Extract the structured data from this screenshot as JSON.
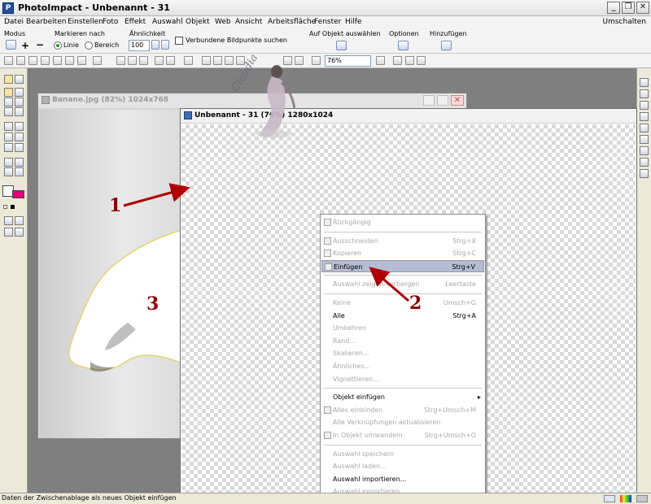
{
  "titlebar": {
    "title": "PhotoImpact - Unbenannt - 31",
    "minimize_icon": "minimize-icon",
    "maximize_icon": "restore-icon",
    "close_icon": "close-icon"
  },
  "menubar": {
    "items": [
      "Datei",
      "Bearbeiten",
      "Einstellen",
      "Foto",
      "Effekt",
      "Auswahl",
      "Objekt",
      "Web",
      "Ansicht",
      "Arbeitsfläche",
      "Fenster",
      "Hilfe"
    ],
    "right": "Umschalten"
  },
  "attributes": {
    "modus_label": "Modus",
    "markieren_label": "Markieren nach",
    "radio_linie": "Linie",
    "radio_bereich": "Bereich",
    "aehnlichkeit_label": "Ähnlichkeit",
    "aehnlichkeit_value": "100",
    "verbundene_label": "Verbundene Bildpunkte suchen",
    "auf_objekt_label": "Auf Objekt auswählen",
    "optionen_label": "Optionen",
    "hinzufuegen_label": "Hinzufügen"
  },
  "toolbar": {
    "zoom_value": "76%"
  },
  "window_banana": {
    "title": "Banane.jpg (82%) 1024x768"
  },
  "window_main": {
    "title": "Unbenannt - 31 (76%) 1280x1024"
  },
  "watermark": "Claudia",
  "context_menu": {
    "items": [
      {
        "label": "Rückgängig",
        "shortcut": "",
        "enabled": false,
        "icon": "undo-icon"
      },
      {
        "sep": true
      },
      {
        "label": "Ausschneiden",
        "shortcut": "Strg+X",
        "enabled": false,
        "icon": "scissors-icon"
      },
      {
        "label": "Kopieren",
        "shortcut": "Strg+C",
        "enabled": false,
        "icon": "copy-icon"
      },
      {
        "label": "Einfügen",
        "shortcut": "Strg+V",
        "enabled": true,
        "icon": "paste-icon",
        "highlight": true
      },
      {
        "sep": true
      },
      {
        "label": "Auswahl zeigen/verbergen",
        "shortcut": "Leertaste",
        "enabled": false
      },
      {
        "sep": true
      },
      {
        "label": "Keine",
        "shortcut": "Umsch+G",
        "enabled": false
      },
      {
        "label": "Alle",
        "shortcut": "Strg+A",
        "enabled": true
      },
      {
        "label": "Umkehren",
        "shortcut": "",
        "enabled": false
      },
      {
        "label": "Rand...",
        "shortcut": "",
        "enabled": false
      },
      {
        "label": "Skalieren...",
        "shortcut": "",
        "enabled": false
      },
      {
        "label": "Ähnliches...",
        "shortcut": "",
        "enabled": false
      },
      {
        "label": "Vignettieren...",
        "shortcut": "",
        "enabled": false
      },
      {
        "sep": true
      },
      {
        "label": "Objekt einfügen",
        "shortcut": "",
        "enabled": true,
        "submenu": true
      },
      {
        "label": "Alles einbinden",
        "shortcut": "Strg+Umsch+M",
        "enabled": false,
        "icon": "merge-icon"
      },
      {
        "label": "Alle Verknüpfungen aktualisieren",
        "shortcut": "",
        "enabled": false
      },
      {
        "label": "In Objekt umwandeln",
        "shortcut": "Strg+Umsch+O",
        "enabled": false,
        "icon": "convert-icon"
      },
      {
        "sep": true
      },
      {
        "label": "Auswahl speichern",
        "shortcut": "",
        "enabled": false
      },
      {
        "label": "Auswahl laden...",
        "shortcut": "",
        "enabled": false
      },
      {
        "label": "Auswahl importieren...",
        "shortcut": "",
        "enabled": true
      },
      {
        "label": "Auswahl exportieren...",
        "shortcut": "",
        "enabled": false
      }
    ]
  },
  "annotations": {
    "num1": "1",
    "num2": "2",
    "num3": "3",
    "arrow_color": "#B00000"
  },
  "statusbar": {
    "text": "Daten der Zwischenablage als neues Objekt einfügen"
  }
}
